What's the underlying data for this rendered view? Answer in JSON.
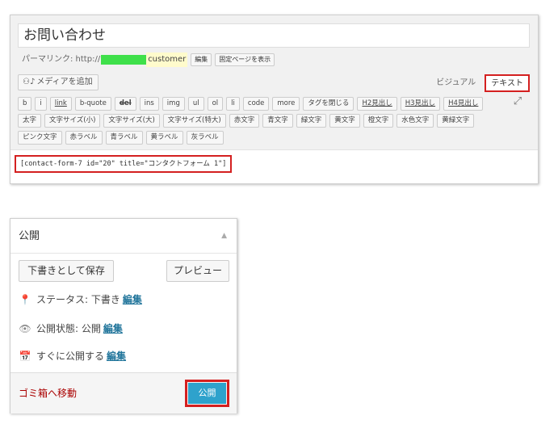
{
  "editor": {
    "title": "お問い合わせ",
    "permalink_label": "パーマリンク: http://",
    "permalink_slug": "customer",
    "edit_button": "編集",
    "view_page_button": "固定ページを表示",
    "media_button": "メディアを追加",
    "tab_visual": "ビジュアル",
    "tab_text": "テキスト",
    "toolbar_row1": [
      "b",
      "i",
      "link",
      "b-quote",
      "del",
      "ins",
      "img",
      "ul",
      "ol",
      "li",
      "code",
      "more",
      "タグを閉じる",
      "H2見出し",
      "H3見出し",
      "H4見出し"
    ],
    "toolbar_row2": [
      "太字",
      "文字サイズ(小)",
      "文字サイズ(大)",
      "文字サイズ(特大)",
      "赤文字",
      "青文字",
      "緑文字",
      "黄文字",
      "橙文字",
      "水色文字",
      "黄緑文字"
    ],
    "toolbar_row3": [
      "ピンク文字",
      "赤ラベル",
      "青ラベル",
      "黄ラベル",
      "灰ラベル"
    ],
    "content": "[contact-form-7 id=\"20\" title=\"コンタクトフォーム 1\"]"
  },
  "publish": {
    "title": "公開",
    "save_draft": "下書きとして保存",
    "preview": "プレビュー",
    "status_label": "ステータス: 下書き",
    "visibility_label": "公開状態: 公開",
    "schedule_label": "すぐに公開する",
    "edit_link": "編集",
    "trash": "ゴミ箱へ移動",
    "publish_button": "公開"
  },
  "colors": {
    "highlight": "#d42020",
    "primary_button": "#2ea2cc",
    "link": "#21759b",
    "trash": "#a00000"
  }
}
